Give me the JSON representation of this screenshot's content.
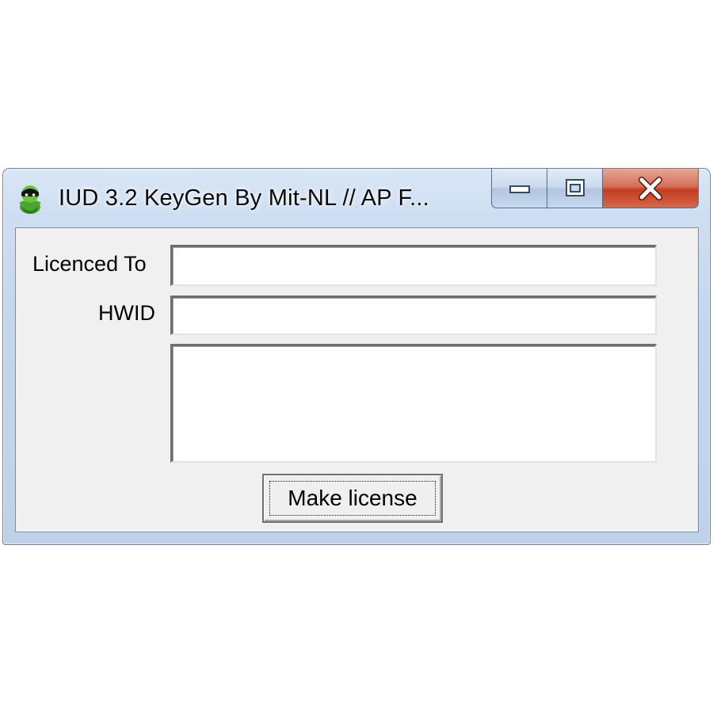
{
  "window": {
    "title": "IUD 3.2 KeyGen By Mit-NL // AP F...",
    "app_icon": "masked-figure-icon",
    "caption_buttons": {
      "minimize_icon": "minimize-icon",
      "maximize_icon": "maximize-icon",
      "close_icon": "close-icon",
      "close_glyph": "✕"
    }
  },
  "form": {
    "licenced_to_label": "Licenced To",
    "licenced_to_value": "",
    "hwid_label": "HWID",
    "hwid_value": "",
    "output_value": "",
    "make_license_label": "Make license"
  },
  "colors": {
    "title_bar": "#cfdff2",
    "client_bg": "#f0f0f0",
    "close_button": "#c23c1f"
  }
}
